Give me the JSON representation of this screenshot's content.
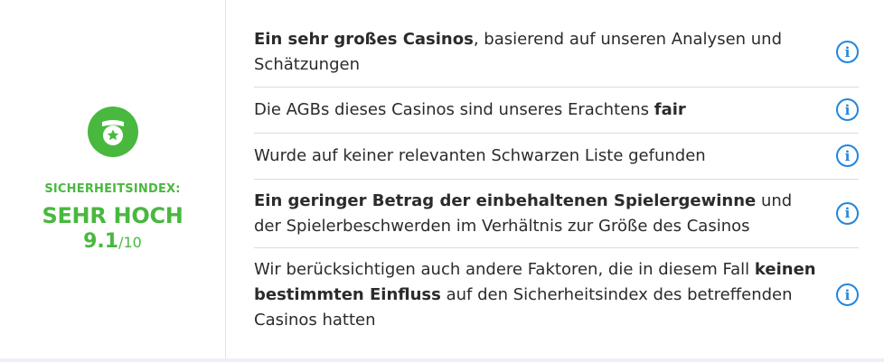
{
  "safety": {
    "label": "SICHERHEITSINDEX:",
    "level": "SEHR HOCH",
    "score": "9.1",
    "score_max": "/10",
    "icon": "shield-star-icon",
    "accent_color": "#49b83f"
  },
  "factors": [
    {
      "parts": [
        {
          "text": "Ein sehr großes Casinos",
          "bold": true
        },
        {
          "text": ", basierend auf unseren Analysen und Schätzungen",
          "bold": false
        }
      ],
      "icon": "info-icon"
    },
    {
      "parts": [
        {
          "text": "Die AGBs dieses Casinos sind unseres Erachtens ",
          "bold": false
        },
        {
          "text": "fair",
          "bold": true
        }
      ],
      "icon": "info-icon"
    },
    {
      "parts": [
        {
          "text": "Wurde auf keiner relevanten Schwarzen Liste gefunden",
          "bold": false
        }
      ],
      "icon": "info-icon"
    },
    {
      "parts": [
        {
          "text": "Ein geringer Betrag der einbehaltenen Spielergewinne",
          "bold": true
        },
        {
          "text": " und der Spielerbeschwerden im Verhältnis zur Größe des Casinos",
          "bold": false
        }
      ],
      "icon": "info-icon"
    },
    {
      "parts": [
        {
          "text": "Wir berücksichtigen auch andere Faktoren, die in diesem Fall ",
          "bold": false
        },
        {
          "text": "keinen bestimmten Einfluss",
          "bold": true
        },
        {
          "text": " auf den Sicherheitsindex des betreffenden Casinos hatten",
          "bold": false
        }
      ],
      "icon": "info-icon"
    }
  ],
  "info_glyph": "i",
  "info_color": "#1f86e0"
}
